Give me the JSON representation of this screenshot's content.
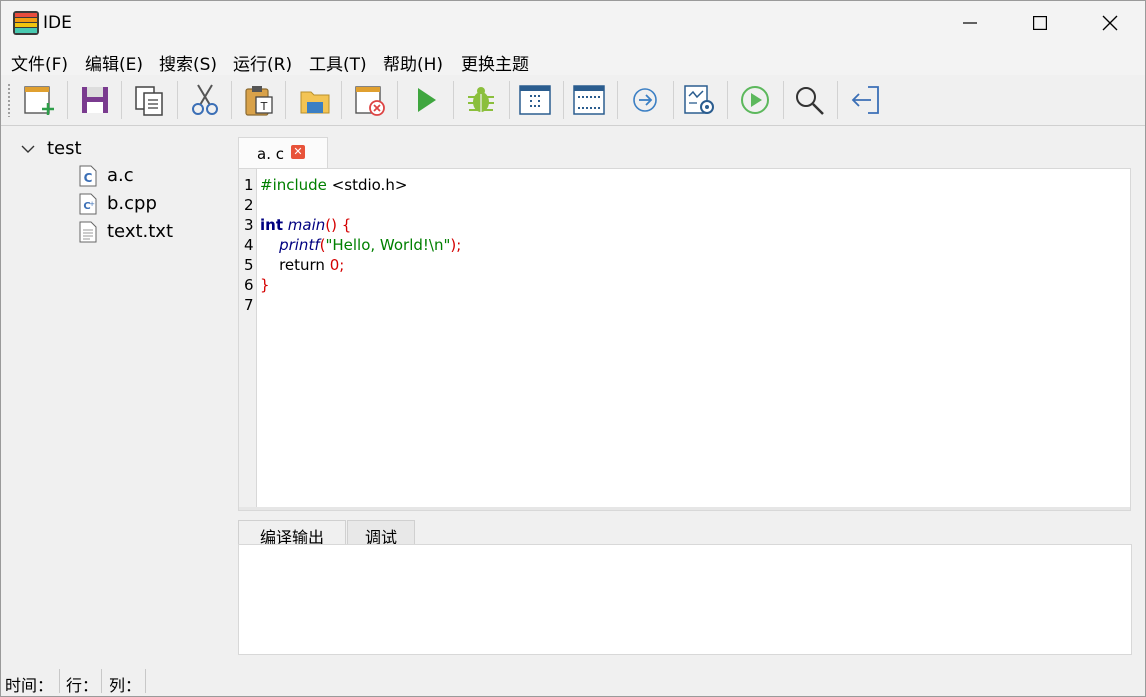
{
  "window": {
    "title": "IDE",
    "minimize_glyph": "—",
    "maximize_glyph": "☐",
    "close_glyph": "✕"
  },
  "menu": [
    {
      "label": "文件(F)"
    },
    {
      "label": "编辑(E)"
    },
    {
      "label": "搜索(S)"
    },
    {
      "label": "运行(R)"
    },
    {
      "label": "工具(T)"
    },
    {
      "label": "帮助(H)"
    },
    {
      "label": "更换主题"
    }
  ],
  "toolbar": {
    "buttons": [
      {
        "icon": "new-file-icon"
      },
      {
        "icon": "save-icon"
      },
      {
        "icon": "copy-icon"
      },
      {
        "icon": "cut-icon"
      },
      {
        "icon": "paste-icon"
      },
      {
        "icon": "open-folder-icon"
      },
      {
        "icon": "close-file-icon"
      },
      {
        "icon": "run-icon"
      },
      {
        "icon": "debug-icon"
      },
      {
        "icon": "window-layout-icon"
      },
      {
        "icon": "window-grid-icon"
      },
      {
        "icon": "step-icon"
      },
      {
        "icon": "settings-icon"
      },
      {
        "icon": "play-circle-icon"
      },
      {
        "icon": "search-icon"
      },
      {
        "icon": "back-icon"
      }
    ]
  },
  "project_tree": {
    "root": {
      "label": "test",
      "expanded": true
    },
    "files": [
      {
        "name": "a.c",
        "icon": "c-file-icon"
      },
      {
        "name": "b.cpp",
        "icon": "cpp-file-icon"
      },
      {
        "name": "text.txt",
        "icon": "text-file-icon"
      }
    ]
  },
  "editor": {
    "tab_label": "a. c",
    "line_numbers": [
      "1",
      "2",
      "3",
      "4",
      "5",
      "6",
      "7"
    ]
  },
  "output_panel": {
    "tabs": [
      {
        "label": "编译输出",
        "active": true
      },
      {
        "label": "调试",
        "active": false
      }
    ],
    "content": ""
  },
  "statusbar": {
    "time_label": "时间：",
    "line_label": "行：",
    "col_label": "列："
  },
  "colors": {
    "keyword": "#000080",
    "string": "#008000",
    "punctuation": "#d40000",
    "close_badge": "#e8533a"
  }
}
